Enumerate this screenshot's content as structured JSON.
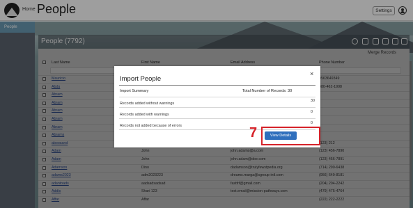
{
  "header": {
    "home_label": "Home",
    "page_title": "People",
    "settings_label": "Settings",
    "logo_icon": "mountain-logo-icon",
    "user_icon": "user-circle-icon"
  },
  "sidebar": {
    "items": [
      {
        "label": "People"
      }
    ]
  },
  "people_panel": {
    "title": "People (7792)",
    "merge_label": "Merge Records",
    "toolbar_icons": [
      "add-icon",
      "email-icon",
      "message-icon",
      "download-icon",
      "upload-icon",
      "delete-icon"
    ]
  },
  "table": {
    "headers": {
      "last_name": "Last Name",
      "first_name": "First Name",
      "email": "Email Address",
      "phone": "Phone Number"
    },
    "rows": [
      {
        "last": "Mauricio",
        "first": "",
        "email": "",
        "phone": "9563649349"
      },
      {
        "last": "Abdu",
        "first": "",
        "email": "",
        "phone": "480-462-1998"
      },
      {
        "last": "Abram",
        "first": "",
        "email": "",
        "phone": ""
      },
      {
        "last": "Abram",
        "first": "",
        "email": "",
        "phone": ""
      },
      {
        "last": "Abram",
        "first": "",
        "email": "",
        "phone": ""
      },
      {
        "last": "Abram",
        "first": "",
        "email": "",
        "phone": ""
      },
      {
        "last": "Abram",
        "first": "",
        "email": "",
        "phone": ""
      },
      {
        "last": "Abrams",
        "first": "",
        "email": "",
        "phone": ""
      },
      {
        "last": "aboosand",
        "first": "",
        "email": "",
        "phone": "(123) 212"
      },
      {
        "last": "Adam",
        "first": "John",
        "email": "john.adams@a.com",
        "phone": "(123) 456-7890"
      },
      {
        "last": "Adam",
        "first": "John",
        "email": "john.adam@doe.com",
        "phone": "(123) 456-7891"
      },
      {
        "last": "Adamson",
        "first": "Dino",
        "email": "dadamson@trulyfewstpedia.org",
        "phone": "(714) 290-6438"
      },
      {
        "last": "adams2023",
        "first": "adm2023223",
        "email": "dreams.marga@sgroup-intl.com",
        "phone": "(956) 649-8181"
      },
      {
        "last": "adantoads",
        "first": "aadsadsadsad",
        "email": "fastfrf@gmail.com",
        "phone": "(204) 204-2242"
      },
      {
        "last": "Addis",
        "first": "Shari 123",
        "email": "test.email@mission-pathways.com",
        "phone": "(479) 475-4764"
      },
      {
        "last": "Affar",
        "first": "Affar",
        "email": "",
        "phone": "(222) 222-2222"
      }
    ]
  },
  "modal": {
    "title": "Import People",
    "close_glyph": "×",
    "summary_label": "Import Summary",
    "total_label": "Total Number of Records: 30",
    "stats": [
      {
        "label": "Records added without warnings",
        "value": "30"
      },
      {
        "label": "Records added with warnings",
        "value": "0"
      },
      {
        "label": "Records not added because of errors",
        "value": "0"
      }
    ],
    "view_details_label": "View Details"
  },
  "annotation": {
    "step_number": "7",
    "highlight_color": "#d6232a"
  },
  "colors": {
    "sidebar_active": "#6b9cb5",
    "primary_button": "#2f6fbd",
    "link": "#24407e"
  }
}
